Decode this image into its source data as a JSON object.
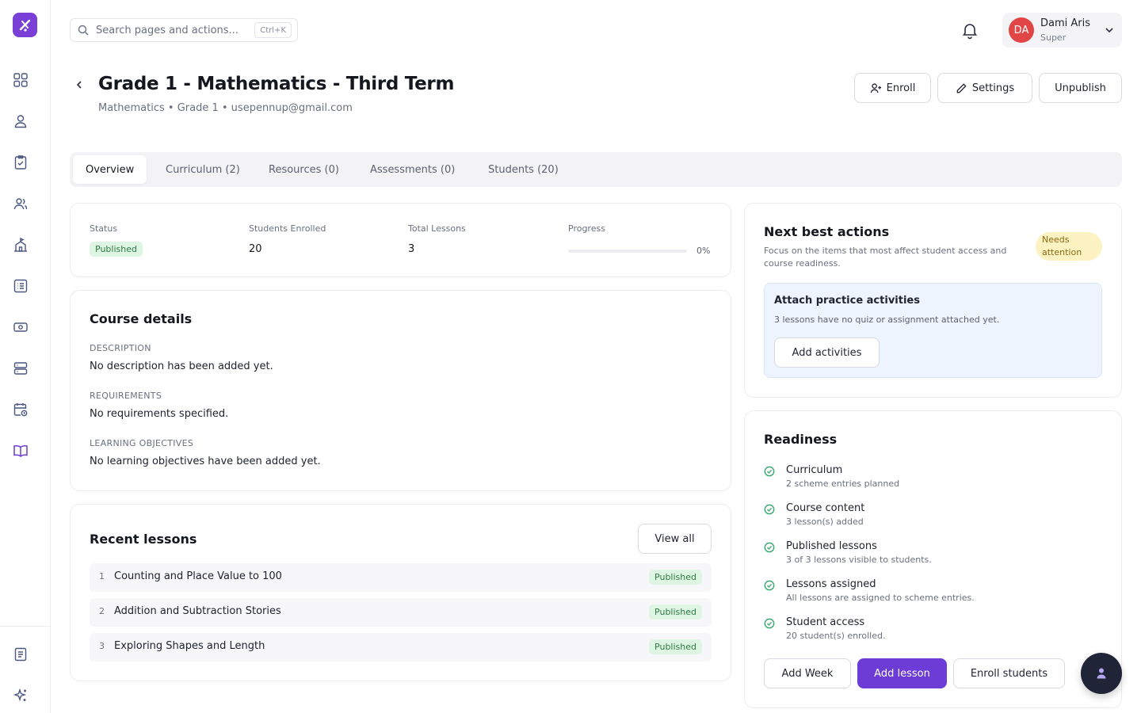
{
  "search": {
    "placeholder": "Search pages and actions...",
    "shortcut": "Ctrl+K"
  },
  "user": {
    "initials": "DA",
    "name": "Dami Aris",
    "role": "Super"
  },
  "sidebar": {
    "items": [
      {
        "icon": "dashboard-icon"
      },
      {
        "icon": "user-icon"
      },
      {
        "icon": "clipboard-check-icon"
      },
      {
        "icon": "users-icon"
      },
      {
        "icon": "school-icon"
      },
      {
        "icon": "list-icon"
      },
      {
        "icon": "cash-icon"
      },
      {
        "icon": "server-icon"
      },
      {
        "icon": "calendar-clock-icon"
      },
      {
        "icon": "book-open-icon"
      }
    ],
    "bottom_items": [
      {
        "icon": "document-icon"
      },
      {
        "icon": "sparkles-icon"
      }
    ]
  },
  "header": {
    "title": "Grade 1 - Mathematics - Third Term",
    "subtitle": "Mathematics • Grade 1 • usepennup@gmail.com",
    "actions": {
      "enroll": "Enroll",
      "settings": "Settings",
      "unpublish": "Unpublish"
    }
  },
  "tabs": [
    {
      "label": "Overview",
      "active": true
    },
    {
      "label": "Curriculum (2)"
    },
    {
      "label": "Resources (0)"
    },
    {
      "label": "Assessments (0)"
    },
    {
      "label": "Students (20)"
    }
  ],
  "stats": {
    "status_label": "Status",
    "status_value": "Published",
    "students_label": "Students Enrolled",
    "students_value": "20",
    "lessons_label": "Total Lessons",
    "lessons_value": "3",
    "progress_label": "Progress",
    "progress_value": "0%",
    "progress_fraction": 0
  },
  "details": {
    "title": "Course details",
    "description_label": "DESCRIPTION",
    "description_text": "No description has been added yet.",
    "requirements_label": "REQUIREMENTS",
    "requirements_text": "No requirements specified.",
    "objectives_label": "LEARNING OBJECTIVES",
    "objectives_text": "No learning objectives have been added yet."
  },
  "lessons": {
    "title": "Recent lessons",
    "view_all": "View all",
    "items": [
      {
        "num": "1",
        "title": "Counting and Place Value to 100",
        "status": "Published"
      },
      {
        "num": "2",
        "title": "Addition and Subtraction Stories",
        "status": "Published"
      },
      {
        "num": "3",
        "title": "Exploring Shapes and Length",
        "status": "Published"
      }
    ]
  },
  "next_actions": {
    "title": "Next best actions",
    "subtitle": "Focus on the items that most affect student access and course readiness.",
    "badge": "Needs attention",
    "action_title": "Attach practice activities",
    "action_desc": "3 lessons have no quiz or assignment attached yet.",
    "action_button": "Add activities"
  },
  "readiness": {
    "title": "Readiness",
    "items": [
      {
        "title": "Curriculum",
        "sub": "2 scheme entries planned"
      },
      {
        "title": "Course content",
        "sub": "3 lesson(s) added"
      },
      {
        "title": "Published lessons",
        "sub": "3 of 3 lessons visible to students."
      },
      {
        "title": "Lessons assigned",
        "sub": "All lessons are assigned to scheme entries."
      },
      {
        "title": "Student access",
        "sub": "20 student(s) enrolled."
      }
    ],
    "buttons": {
      "add_week": "Add Week",
      "add_lesson": "Add lesson",
      "enroll_students": "Enroll students"
    }
  },
  "colors": {
    "accent": "#6d3bd6",
    "published_bg": "#dff5e4",
    "attention_bg": "#fdf3c2",
    "check": "#2fa66b"
  }
}
